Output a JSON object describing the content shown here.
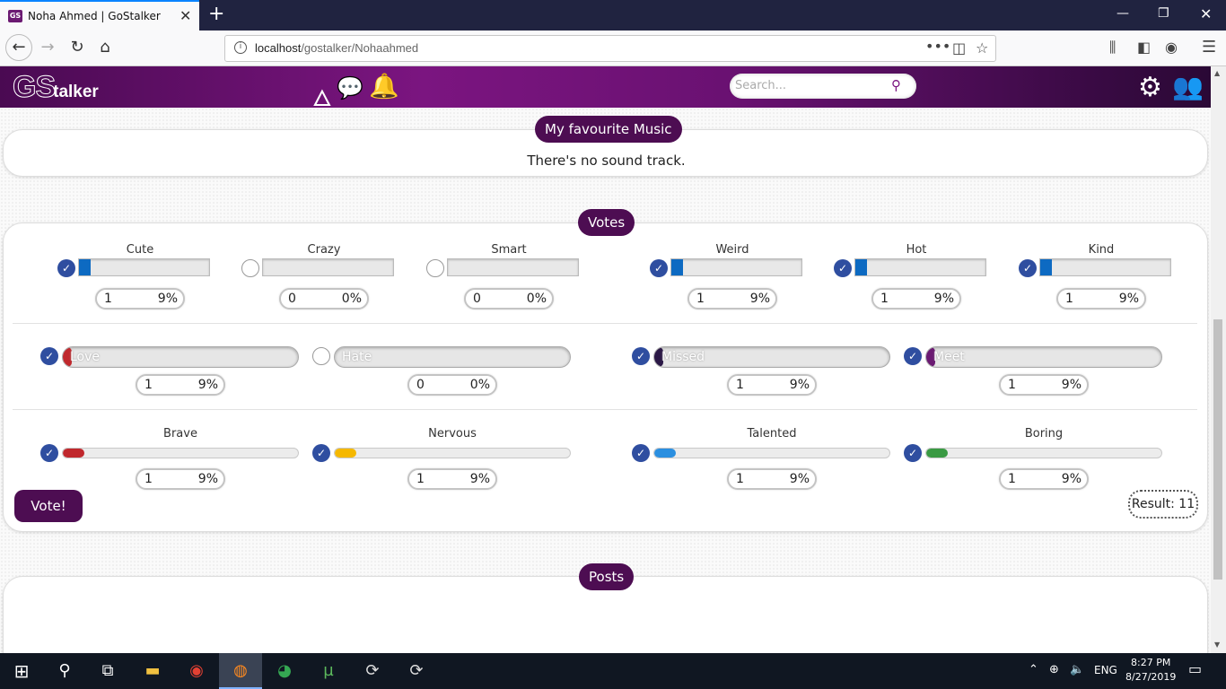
{
  "browser": {
    "tab_title": "Noha Ahmed | GoStalker",
    "tab_favicon": "GS",
    "url_host": "localhost",
    "url_path": "/gostalker/Nohaahmed"
  },
  "site": {
    "logo_gs": "GS",
    "logo_rest": "talker",
    "search_placeholder": "Search..."
  },
  "music": {
    "heading": "My favourite Music",
    "message": "There's no sound track."
  },
  "votes": {
    "heading": "Votes",
    "row1": [
      {
        "label": "Cute",
        "checked": true,
        "count": "1",
        "percent": "9%"
      },
      {
        "label": "Crazy",
        "checked": false,
        "count": "0",
        "percent": "0%"
      },
      {
        "label": "Smart",
        "checked": false,
        "count": "0",
        "percent": "0%"
      },
      {
        "label": "Weird",
        "checked": true,
        "count": "1",
        "percent": "9%"
      },
      {
        "label": "Hot",
        "checked": true,
        "count": "1",
        "percent": "9%"
      },
      {
        "label": "Kind",
        "checked": true,
        "count": "1",
        "percent": "9%"
      }
    ],
    "row2": [
      {
        "label": "Love",
        "checked": true,
        "count": "1",
        "percent": "9%",
        "color": "#c0282d"
      },
      {
        "label": "Hate",
        "checked": false,
        "count": "0",
        "percent": "0%",
        "color": "#c0282d"
      },
      {
        "label": "Missed",
        "checked": true,
        "count": "1",
        "percent": "9%",
        "color": "#2b1846"
      },
      {
        "label": "Meet",
        "checked": true,
        "count": "1",
        "percent": "9%",
        "color": "#6b1a72"
      }
    ],
    "row3": [
      {
        "label": "Brave",
        "checked": true,
        "count": "1",
        "percent": "9%",
        "color": "#c0282d"
      },
      {
        "label": "Nervous",
        "checked": true,
        "count": "1",
        "percent": "9%",
        "color": "#f5b800"
      },
      {
        "label": "Talented",
        "checked": true,
        "count": "1",
        "percent": "9%",
        "color": "#2b8fe0"
      },
      {
        "label": "Boring",
        "checked": true,
        "count": "1",
        "percent": "9%",
        "color": "#3a9a43"
      }
    ],
    "vote_button": "Vote!",
    "result": "Result: 11"
  },
  "posts": {
    "heading": "Posts"
  },
  "taskbar": {
    "lang": "ENG",
    "time": "8:27 PM",
    "date": "8/27/2019"
  },
  "colors": {
    "brand": "#4d0d52",
    "check": "#2f4ea0",
    "bar_fill": "#0d6ac2"
  }
}
